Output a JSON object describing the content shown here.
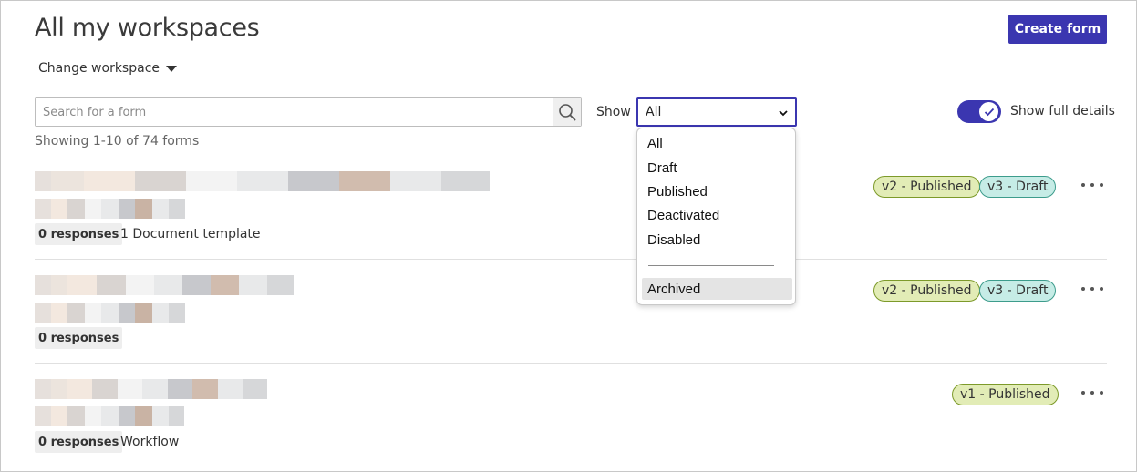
{
  "page": {
    "title": "All my workspaces",
    "change_workspace": "Change workspace",
    "create_form": "Create form"
  },
  "filters": {
    "search_placeholder": "Search for a form",
    "search_value": "",
    "show_label": "Show",
    "show_selected": "All",
    "show_options": [
      "All",
      "Draft",
      "Published",
      "Deactivated",
      "Disabled",
      "Archived"
    ],
    "full_details_label": "Show full details",
    "full_details_on": true
  },
  "summary": "Showing 1-10 of 74 forms",
  "forms": [
    {
      "responses": "0 responses",
      "extra": "1 Document template",
      "versions": [
        {
          "label": "v2 - Published",
          "status": "published"
        },
        {
          "label": "v3 - Draft",
          "status": "draft"
        }
      ]
    },
    {
      "responses": "0 responses",
      "extra": "",
      "versions": [
        {
          "label": "v2 - Published",
          "status": "published"
        },
        {
          "label": "v3 - Draft",
          "status": "draft"
        }
      ]
    },
    {
      "responses": "0 responses",
      "extra": "Workflow",
      "versions": [
        {
          "label": "v1 - Published",
          "status": "published"
        }
      ]
    }
  ],
  "colors": {
    "accent": "#3b36b0",
    "published_bg": "#e2ecb6",
    "published_border": "#7d9a2a",
    "draft_bg": "#c6ece6",
    "draft_border": "#3d9c8c"
  },
  "icons": {
    "search": "search-icon",
    "caret": "caret-down-icon",
    "chevron": "chevron-down-icon",
    "check": "check-icon",
    "more": "more-options-icon"
  }
}
